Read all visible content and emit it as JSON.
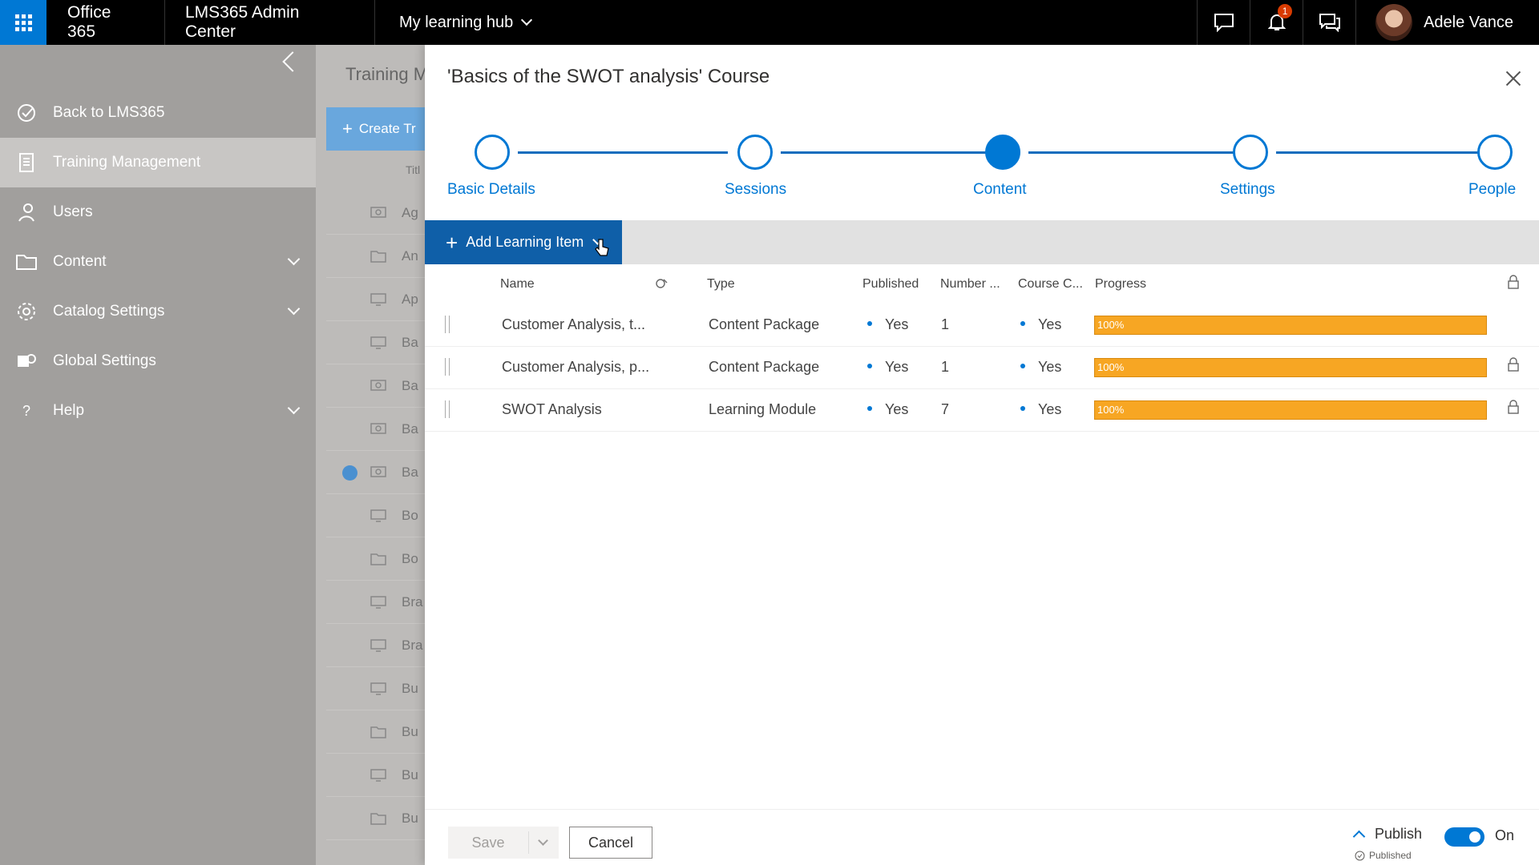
{
  "topbar": {
    "brand": "Office 365",
    "app": "LMS365 Admin Center",
    "hub": "My learning hub",
    "notification_count": "1",
    "user_name": "Adele Vance"
  },
  "leftnav": {
    "items": [
      {
        "label": "Back to LMS365"
      },
      {
        "label": "Training Management"
      },
      {
        "label": "Users"
      },
      {
        "label": "Content"
      },
      {
        "label": "Catalog Settings"
      },
      {
        "label": "Global Settings"
      },
      {
        "label": "Help"
      }
    ]
  },
  "background_list": {
    "title": "Training M",
    "create_label": "Create Tr",
    "col_title": "Titl",
    "rows": [
      "Ag",
      "An",
      "Ap",
      "Ba",
      "Ba",
      "Ba",
      "Ba",
      "Bo",
      "Bo",
      "Bra",
      "Bra",
      "Bu",
      "Bu",
      "Bu",
      "Bu"
    ]
  },
  "panel": {
    "title": "'Basics of the SWOT analysis' Course",
    "steps": [
      {
        "label": "Basic Details"
      },
      {
        "label": "Sessions"
      },
      {
        "label": "Content"
      },
      {
        "label": "Settings"
      },
      {
        "label": "People"
      }
    ],
    "add_item_label": "Add Learning Item",
    "columns": {
      "name": "Name",
      "type": "Type",
      "published": "Published",
      "number": "Number ...",
      "course_c": "Course C...",
      "progress": "Progress"
    },
    "rows": [
      {
        "name": "Customer Analysis, t...",
        "type": "Content Package",
        "published": "Yes",
        "number": "1",
        "course_c": "Yes",
        "progress": "100%"
      },
      {
        "name": "Customer Analysis, p...",
        "type": "Content Package",
        "published": "Yes",
        "number": "1",
        "course_c": "Yes",
        "progress": "100%"
      },
      {
        "name": "SWOT Analysis",
        "type": "Learning Module",
        "published": "Yes",
        "number": "7",
        "course_c": "Yes",
        "progress": "100%"
      }
    ],
    "footer": {
      "save_label": "Save",
      "cancel_label": "Cancel",
      "publish_label": "Publish",
      "published_note": "Published",
      "toggle_label": "On"
    }
  },
  "colors": {
    "accent": "#0078d4",
    "progress": "#f7a623",
    "topbar": "#000000",
    "nav": "#a19f9d"
  }
}
